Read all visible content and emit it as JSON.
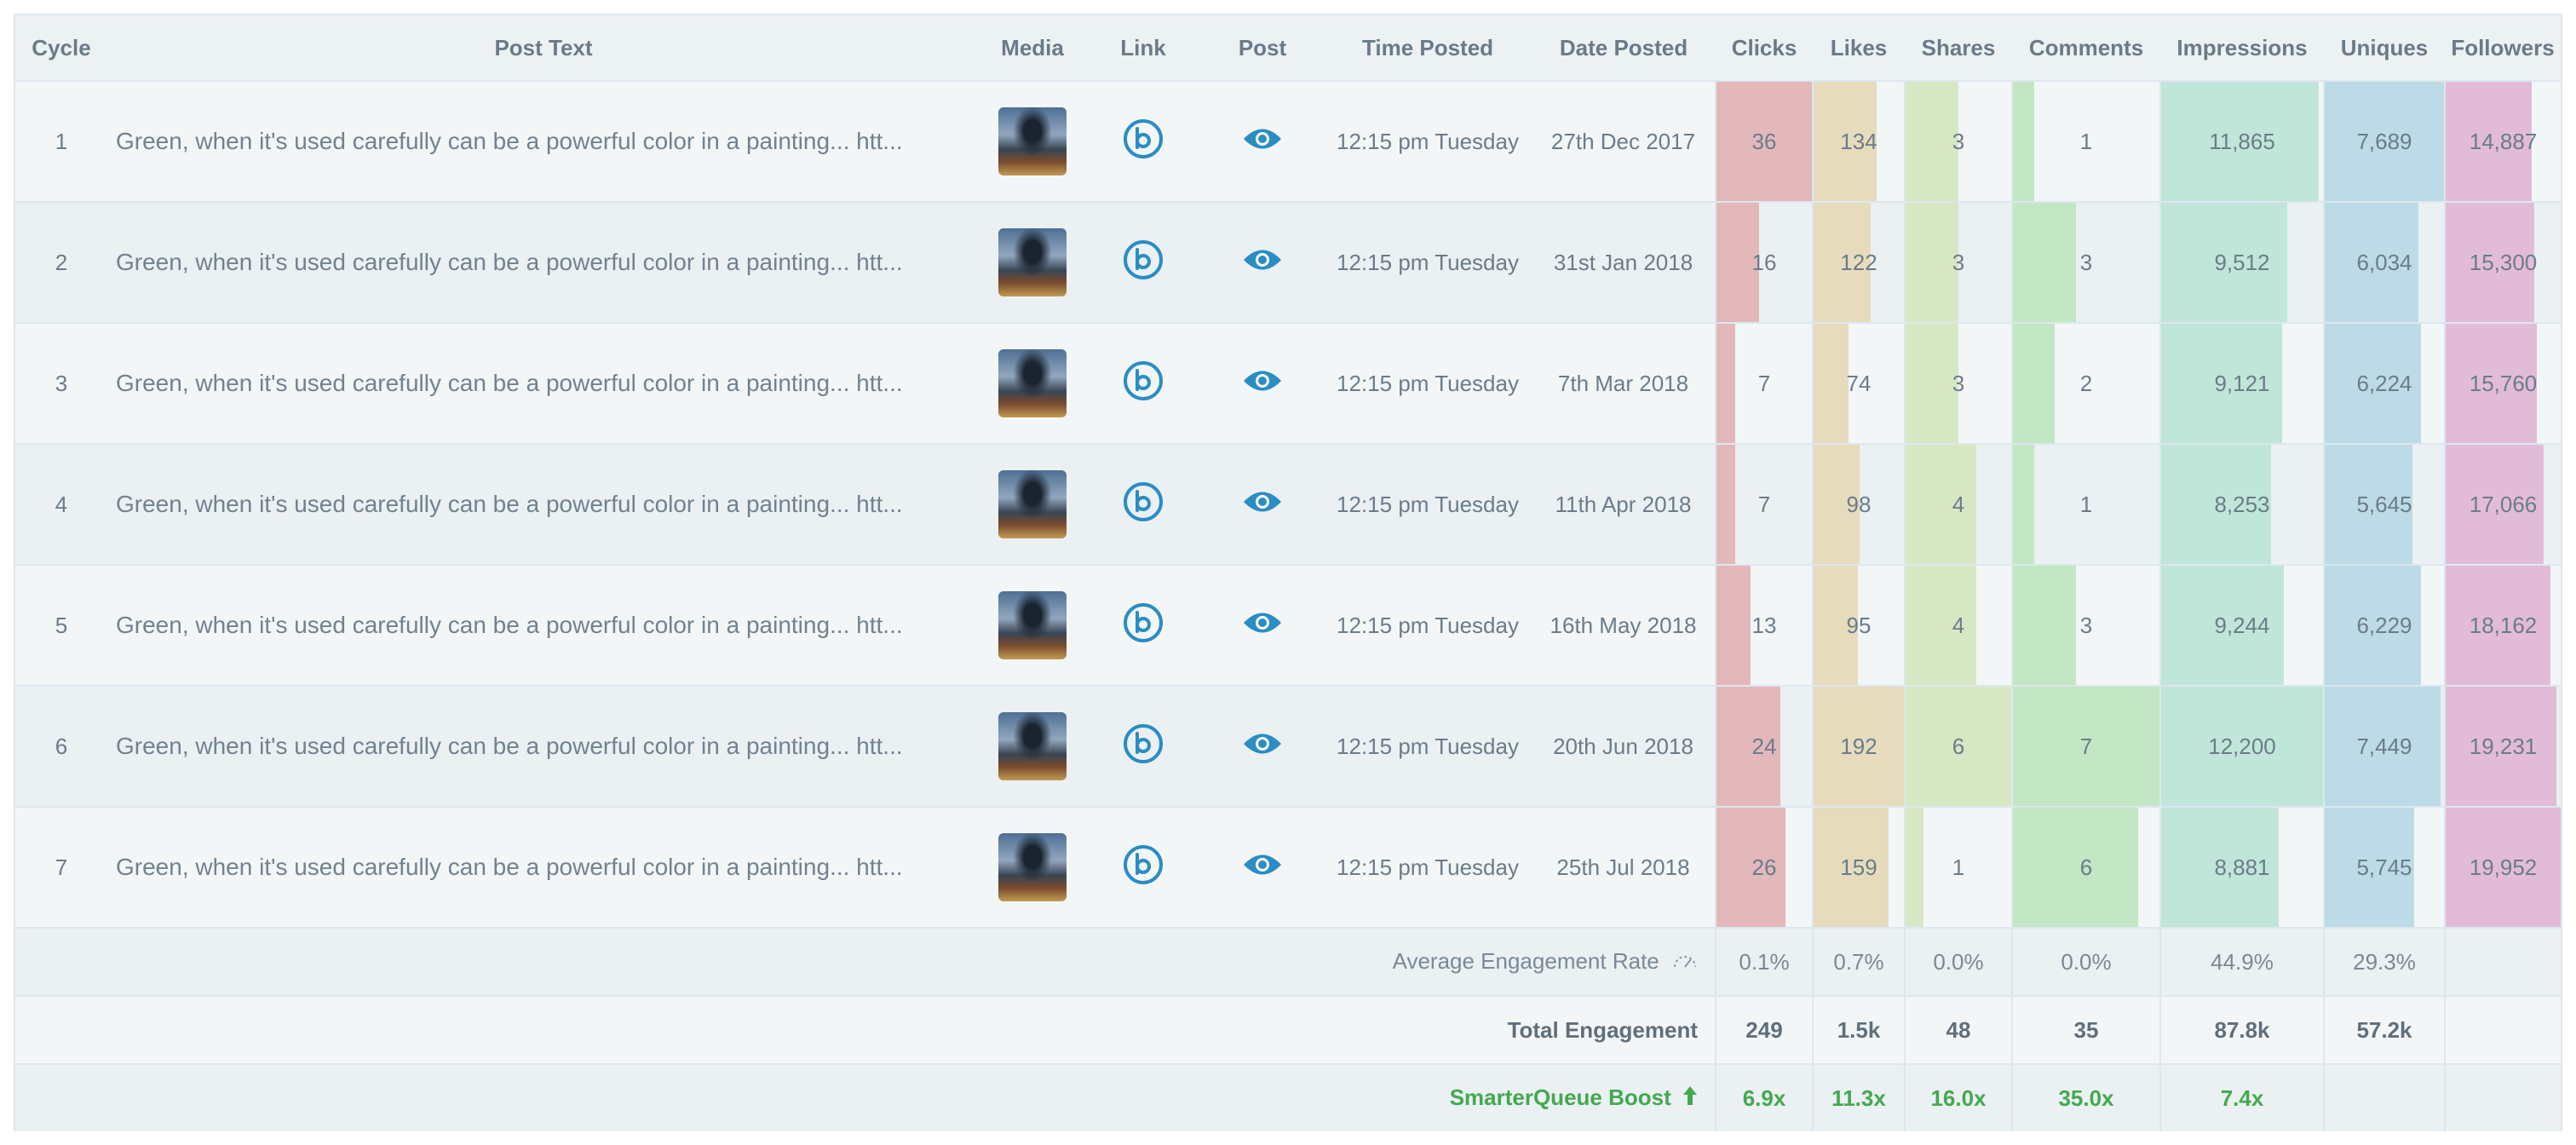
{
  "headers": {
    "cycle": "Cycle",
    "post_text": "Post Text",
    "media": "Media",
    "link": "Link",
    "post": "Post",
    "time": "Time Posted",
    "date": "Date Posted",
    "clicks": "Clicks",
    "likes": "Likes",
    "shares": "Shares",
    "comments": "Comments",
    "impressions": "Impressions",
    "uniques": "Uniques",
    "followers": "Followers"
  },
  "icons": {
    "media": "thumbnail-image",
    "link": "bitly-link-icon",
    "post": "eye-icon",
    "engagement": "gauge-icon",
    "boost": "arrow-up-icon"
  },
  "colors": {
    "clicks": "#e3b8bb",
    "likes": "#e6dbbd",
    "shares": "#d8e7c3",
    "comments": "#c3e6c4",
    "impressions": "#bfe6d8",
    "uniques": "#bcdbe6",
    "followers": "#e2bbd8",
    "accent": "#2a8dc4",
    "boost": "#43a94f"
  },
  "rows": [
    {
      "cycle": "1",
      "text": "Green, when it's used carefully can be a powerful color in a painting... htt...",
      "time": "12:15 pm Tuesday",
      "date": "27th Dec 2017",
      "clicks": "36",
      "likes": "134",
      "shares": "3",
      "comments": "1",
      "impressions": "11,865",
      "uniques": "7,689",
      "followers": "14,887"
    },
    {
      "cycle": "2",
      "text": "Green, when it's used carefully can be a powerful color in a painting... htt...",
      "time": "12:15 pm Tuesday",
      "date": "31st Jan 2018",
      "clicks": "16",
      "likes": "122",
      "shares": "3",
      "comments": "3",
      "impressions": "9,512",
      "uniques": "6,034",
      "followers": "15,300"
    },
    {
      "cycle": "3",
      "text": "Green, when it's used carefully can be a powerful color in a painting... htt...",
      "time": "12:15 pm Tuesday",
      "date": "7th Mar 2018",
      "clicks": "7",
      "likes": "74",
      "shares": "3",
      "comments": "2",
      "impressions": "9,121",
      "uniques": "6,224",
      "followers": "15,760"
    },
    {
      "cycle": "4",
      "text": "Green, when it's used carefully can be a powerful color in a painting... htt...",
      "time": "12:15 pm Tuesday",
      "date": "11th Apr 2018",
      "clicks": "7",
      "likes": "98",
      "shares": "4",
      "comments": "1",
      "impressions": "8,253",
      "uniques": "5,645",
      "followers": "17,066"
    },
    {
      "cycle": "5",
      "text": "Green, when it's used carefully can be a powerful color in a painting... htt...",
      "time": "12:15 pm Tuesday",
      "date": "16th May 2018",
      "clicks": "13",
      "likes": "95",
      "shares": "4",
      "comments": "3",
      "impressions": "9,244",
      "uniques": "6,229",
      "followers": "18,162"
    },
    {
      "cycle": "6",
      "text": "Green, when it's used carefully can be a powerful color in a painting... htt...",
      "time": "12:15 pm Tuesday",
      "date": "20th Jun 2018",
      "clicks": "24",
      "likes": "192",
      "shares": "6",
      "comments": "7",
      "impressions": "12,200",
      "uniques": "7,449",
      "followers": "19,231"
    },
    {
      "cycle": "7",
      "text": "Green, when it's used carefully can be a powerful color in a painting... htt...",
      "time": "12:15 pm Tuesday",
      "date": "25th Jul 2018",
      "clicks": "26",
      "likes": "159",
      "shares": "1",
      "comments": "6",
      "impressions": "8,881",
      "uniques": "5,745",
      "followers": "19,952"
    }
  ],
  "bar_scale_max": {
    "clicks": 36,
    "likes": 192,
    "shares": 6,
    "comments": 7,
    "impressions": 12200,
    "uniques": 7689,
    "followers": 19952
  },
  "footer": {
    "avg_label": "Average Engagement Rate",
    "avg": {
      "clicks": "0.1%",
      "likes": "0.7%",
      "shares": "0.0%",
      "comments": "0.0%",
      "impressions": "44.9%",
      "uniques": "29.3%"
    },
    "total_label": "Total Engagement",
    "total": {
      "clicks": "249",
      "likes": "1.5k",
      "shares": "48",
      "comments": "35",
      "impressions": "87.8k",
      "uniques": "57.2k"
    },
    "boost_label": "SmarterQueue Boost",
    "boost": {
      "clicks": "6.9x",
      "likes": "11.3x",
      "shares": "16.0x",
      "comments": "35.0x",
      "impressions": "7.4x"
    }
  }
}
